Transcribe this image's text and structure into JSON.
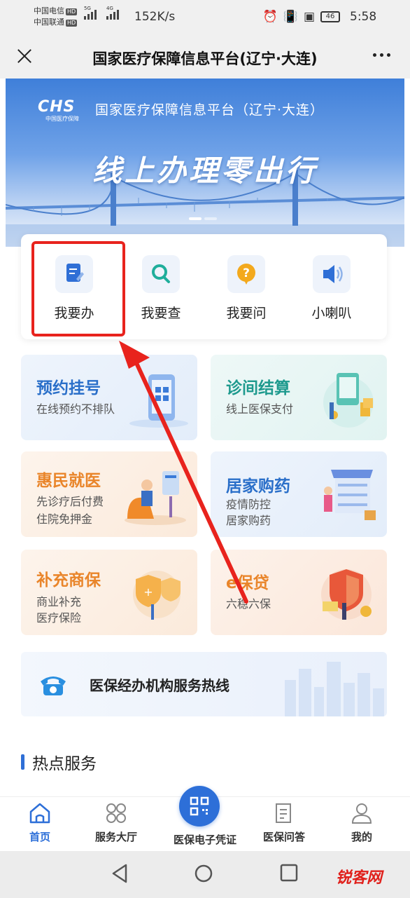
{
  "status_bar": {
    "carrier1": "中国电信",
    "carrier2": "中国联通",
    "hd": "HD",
    "net1": "5G",
    "net2": "4G",
    "speed": "152K/s",
    "battery": "46",
    "time": "5:58"
  },
  "title_bar": {
    "title": "国家医疗保障信息平台(辽宁·大连)"
  },
  "banner": {
    "logo_text": "CHS",
    "logo_sub": "中国医疗保障",
    "subtitle": "国家医疗保障信息平台（辽宁·大连）",
    "headline": "线上办理零出行"
  },
  "quick_menu": [
    {
      "label": "我要办",
      "icon": "document-edit-icon"
    },
    {
      "label": "我要查",
      "icon": "search-icon"
    },
    {
      "label": "我要问",
      "icon": "question-icon"
    },
    {
      "label": "小喇叭",
      "icon": "speaker-icon"
    }
  ],
  "services": [
    {
      "title": "预约挂号",
      "desc": [
        "在线预约不排队"
      ],
      "title_color": "#2a6fc9"
    },
    {
      "title": "诊间结算",
      "desc": [
        "线上医保支付"
      ],
      "title_color": "#1e9a8e"
    },
    {
      "title": "惠民就医",
      "desc": [
        "先诊疗后付费",
        "住院免押金"
      ],
      "title_color": "#e9852a"
    },
    {
      "title": "居家购药",
      "desc": [
        "疫情防控",
        "居家购药"
      ],
      "title_color": "#2a6fc9"
    },
    {
      "title": "补充商保",
      "desc": [
        "商业补充",
        "医疗保险"
      ],
      "title_color": "#e9852a"
    },
    {
      "title": "e保贷",
      "desc": [
        "六稳六保"
      ],
      "title_color": "#e9852a"
    }
  ],
  "hotline": {
    "label": "医保经办机构服务热线"
  },
  "hot_section": {
    "title": "热点服务"
  },
  "tabs": [
    {
      "label": "首页",
      "icon": "home-icon",
      "active": true
    },
    {
      "label": "服务大厅",
      "icon": "grid-icon",
      "active": false
    },
    {
      "label": "医保电子凭证",
      "icon": "qr-code-icon",
      "active": false
    },
    {
      "label": "医保问答",
      "icon": "qa-icon",
      "active": false
    },
    {
      "label": "我的",
      "icon": "user-icon",
      "active": false
    }
  ],
  "watermark": "锐客网",
  "colors": {
    "accent": "#2d6fd8",
    "highlight": "#e8231d"
  }
}
